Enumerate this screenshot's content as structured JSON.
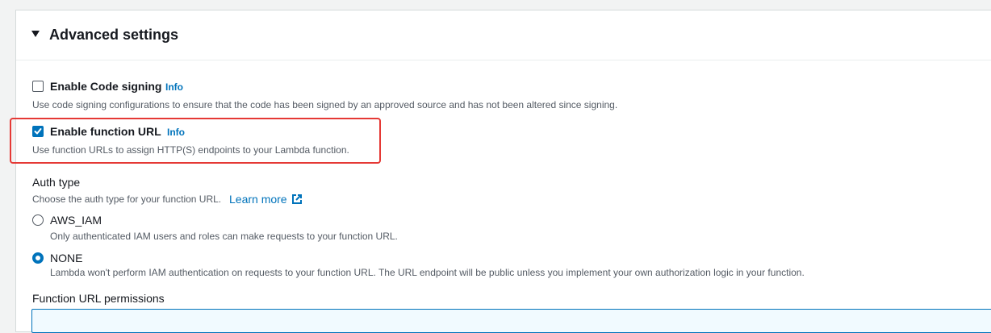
{
  "advanced": {
    "title": "Advanced settings"
  },
  "code_signing": {
    "label": "Enable Code signing",
    "info": "Info",
    "description": "Use code signing configurations to ensure that the code has been signed by an approved source and has not been altered since signing.",
    "checked": false
  },
  "function_url": {
    "label": "Enable function URL",
    "info": "Info",
    "description": "Use function URLs to assign HTTP(S) endpoints to your Lambda function.",
    "checked": true
  },
  "auth_type": {
    "label": "Auth type",
    "description": "Choose the auth type for your function URL.",
    "learn_more": "Learn more",
    "options": [
      {
        "label": "AWS_IAM",
        "description": "Only authenticated IAM users and roles can make requests to your function URL.",
        "selected": false
      },
      {
        "label": "NONE",
        "description": "Lambda won't perform IAM authentication on requests to your function URL. The URL endpoint will be public unless you implement your own authorization logic in your function.",
        "selected": true
      }
    ]
  },
  "permissions": {
    "label": "Function URL permissions"
  },
  "colors": {
    "accent": "#0073bb",
    "highlight": "#e53935"
  },
  "icons": {
    "caret": "caret-down-icon",
    "external": "external-link-icon",
    "check": "checkmark-icon"
  }
}
